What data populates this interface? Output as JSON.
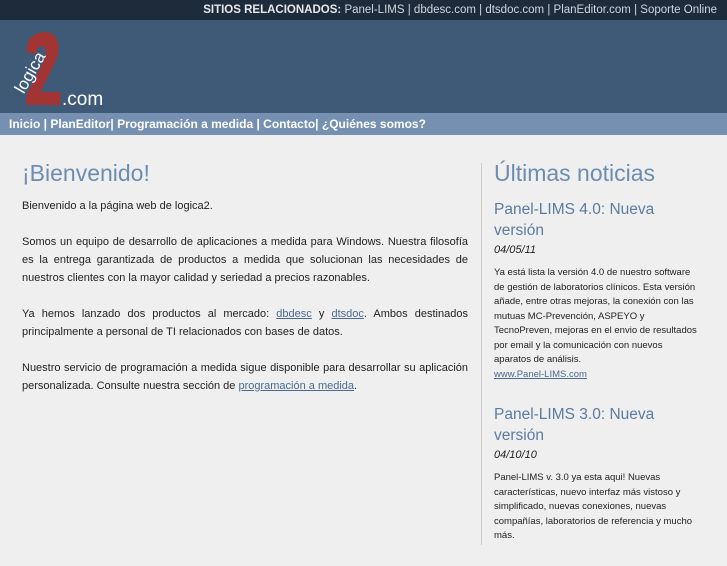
{
  "topbar": {
    "label": "SITIOS RELACIONADOS:",
    "links": [
      "Panel-LIMS",
      "dbdesc.com",
      "dtsdoc.com",
      "PlanEditor.com",
      "Soporte Online"
    ]
  },
  "logo": {
    "text": "logica2.com"
  },
  "nav": [
    "Inicio",
    "PlanEditor",
    "Programación a medida",
    "Contacto",
    "¿Quiénes somos?"
  ],
  "main": {
    "title": "¡Bienvenido!",
    "p1": "Bienvenido a la página web de logica2.",
    "p2": "Somos un equipo de desarrollo de aplicaciones a medida para Windows. Nuestra filosofía es la entrega garantizada de productos a medida que solucionan las necesidades de nuestros clientes con la mayor calidad y seriedad a precios razonables.",
    "p3a": "Ya hemos lanzado dos productos al mercado: ",
    "p3link1": "dbdesc",
    "p3b": " y ",
    "p3link2": "dtsdoc",
    "p3c": ". Ambos destinados principalmente a personal de TI relacionados con bases de datos.",
    "p4a": "Nuestro servicio de programación a medida sigue disponible para desarrollar su aplicación personalizada. Consulte nuestra sección de ",
    "p4link": "programación a medida",
    "p4b": "."
  },
  "news": {
    "title": "Últimas noticias",
    "items": [
      {
        "title": "Panel-LIMS 4.0: Nueva versión",
        "date": "04/05/11",
        "body": "Ya está lista la versión 4.0 de nuestro software de gestión de laboratorios clínicos. Esta versión añade, entre otras mejoras, la conexión con las mutuas MC-Prevención, ASPEYO y TecnoPreven, mejoras en el envio de resultados por email y la comunicación con nuevos aparatos de análisis.",
        "link": "www.Panel-LIMS.com"
      },
      {
        "title": "Panel-LIMS 3.0: Nueva versión",
        "date": "04/10/10",
        "body": "Panel-LIMS v. 3.0 ya esta aqui! Nuevas características, nuevo interfaz más vistoso y simplificado, nuevas conexiones, nuevas compañías, laboratorios de referencia y mucho más."
      }
    ]
  }
}
